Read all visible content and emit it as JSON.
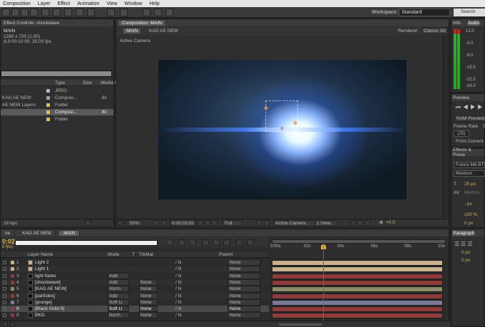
{
  "menu": [
    "Composition",
    "Layer",
    "Effect",
    "Animation",
    "View",
    "Window",
    "Help"
  ],
  "workspace": {
    "label": "Workspace:",
    "value": "Standard"
  },
  "search_help": "Search Help",
  "effect_controls": {
    "tab": "Effect Controls: shockwave",
    "name": "MAIN",
    "size": "1280 x 720 (1.00)",
    "duration": "Δ 0:00:10:00, 25.00 fps"
  },
  "project": {
    "headers": [
      "Type",
      "Size",
      "Media D"
    ],
    "rows": [
      {
        "name": "",
        "type": "JPEG",
        "color": "#b3b3d9"
      },
      {
        "name": "KAG AE NEW",
        "type": "Composi...",
        "size": "8c",
        "color": "#9e9e9e"
      },
      {
        "name": "AE NEW Layers",
        "type": "Folder",
        "color": "#e0c24a"
      },
      {
        "name": "",
        "type": "Composi...",
        "size": "8c",
        "color": "#e0c24a"
      },
      {
        "name": "",
        "type": "Folder",
        "color": "#e0c24a"
      }
    ],
    "bpc": "16 bpc"
  },
  "composition": {
    "tab": "Composition: MAIN",
    "crumbs": [
      "MAIN",
      "KAG AE NEW"
    ],
    "renderer_label": "Renderer:",
    "renderer": "Classic 3D",
    "camera_label": "Active Camera",
    "zoom": "50%",
    "timecode": "0:00:03:02",
    "quality": "Full",
    "view": "Active Camera",
    "views": "1 View",
    "exposure": "+0.0"
  },
  "info": {
    "tab": "Info",
    "audio_tab": "Audio",
    "scale": [
      "6.0",
      "0.0",
      "-6.0",
      "-12.0",
      "-18.0",
      "-24.0"
    ],
    "right": [
      "12.0",
      "",
      "-3.0",
      "",
      "-9.0",
      "",
      "-15.0",
      "",
      "-21.0",
      "-24.0"
    ]
  },
  "preview": {
    "tab": "Preview",
    "ram": "RAM Preview O",
    "frame_rate": "Frame Rate",
    "fps": "(25)",
    "sk": "Sk",
    "from": "From Current"
  },
  "effects": {
    "tab": "Effects & Prese",
    "font": "Futura Md BT",
    "weight": "Medium",
    "size": "25 px",
    "tracking": "Metrics",
    "lead": "- px",
    "scale": "100 %",
    "base": "0 px"
  },
  "paragraph": {
    "tab": "Paragraph",
    "v1": "0 px",
    "v2": "0 px"
  },
  "timeline": {
    "tabs": [
      "ne",
      "KAG AE NEW",
      "MAIN"
    ],
    "timecode": "0:02",
    "fps": "5 fps)",
    "search": "",
    "headers": {
      "layer": "Layer Name",
      "mode": "Mode",
      "t": "T",
      "trkmat": "TrkMat",
      "parent": "Parent"
    },
    "ruler": [
      "0:00s",
      "02s",
      "04s",
      "06s",
      "08s",
      "10s"
    ],
    "layers": [
      {
        "num": "1",
        "name": "Light 2",
        "mode": "",
        "trk": "",
        "parent": "None",
        "color": "#c9b08d"
      },
      {
        "num": "2",
        "name": "Light 1",
        "mode": "",
        "trk": "",
        "parent": "None",
        "color": "#c9b08d"
      },
      {
        "num": "3",
        "name": "light flares",
        "mode": "Add",
        "trk": "",
        "parent": "None",
        "color": "#8e3b3b"
      },
      {
        "num": "4",
        "name": "[shockwave]",
        "mode": "Add",
        "trk": "None",
        "parent": "None",
        "color": "#8e3b3b"
      },
      {
        "num": "5",
        "name": "[KAG AE NEW]",
        "mode": "Norm",
        "trk": "None",
        "parent": "None",
        "color": "#8c8c6a"
      },
      {
        "num": "6",
        "name": "[particles]",
        "mode": "Add",
        "trk": "None",
        "parent": "None",
        "color": "#8e3b3b"
      },
      {
        "num": "7",
        "name": "[grunge]",
        "mode": "Soft Li",
        "trk": "None",
        "parent": "None",
        "color": "#7a7a95"
      },
      {
        "num": "8",
        "name": "[Black Solid 9]",
        "mode": "Soft Li",
        "trk": "None",
        "parent": "None",
        "color": "#8e3b3b"
      },
      {
        "num": "9",
        "name": "BKG",
        "mode": "Norm",
        "trk": "None",
        "parent": "None",
        "color": "#8e3b3b"
      }
    ]
  }
}
